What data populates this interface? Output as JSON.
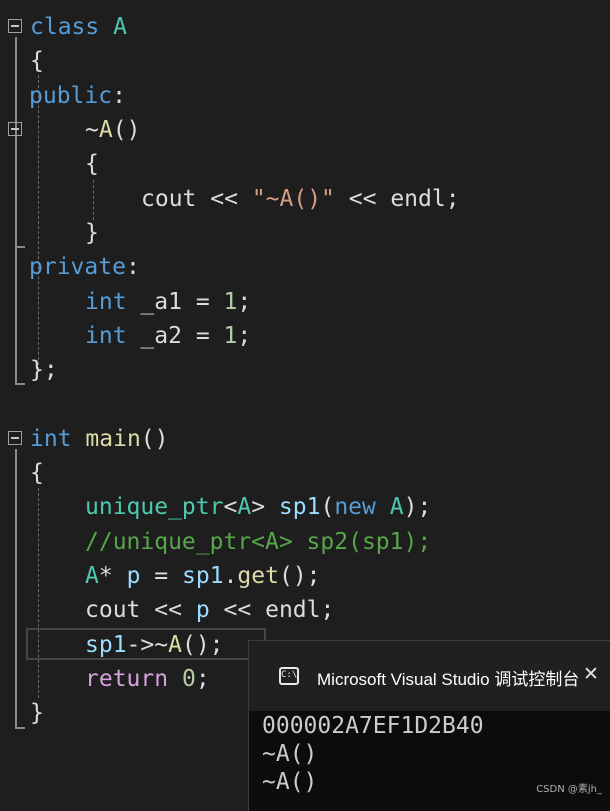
{
  "code": {
    "class_kw": "class",
    "class_name": "A",
    "brace_open": "{",
    "public_kw": "public",
    "colon": ":",
    "dtor_tilde": "~",
    "dtor_name": "A",
    "parens": "()",
    "cout": "cout",
    "shl": "<<",
    "dtor_str": "\"~A()\"",
    "endl": "endl",
    "semi": ";",
    "brace_close": "}",
    "private_kw": "private",
    "int_kw": "int",
    "a1": "_a1",
    "a2": "_a2",
    "eq": "=",
    "one": "1",
    "class_end": "};",
    "main": "main",
    "unique_ptr": "unique_ptr",
    "lt": "<",
    "gt": ">",
    "sp1": "sp1",
    "lparen": "(",
    "new_kw": "new",
    "rparen": ")",
    "comment": "//unique_ptr<A> sp2(sp1);",
    "ptr_A": "A",
    "star": "*",
    "p": "p",
    "dot": ".",
    "get": "get",
    "arrow": "->",
    "return_kw": "return",
    "zero": "0"
  },
  "console": {
    "title": "Microsoft Visual Studio 调试控制台",
    "icon_text": "C:\\",
    "close": "✕",
    "output": [
      "000002A7EF1D2B40",
      "~A()",
      "~A()"
    ]
  },
  "watermark": "CSDN @素jh_"
}
